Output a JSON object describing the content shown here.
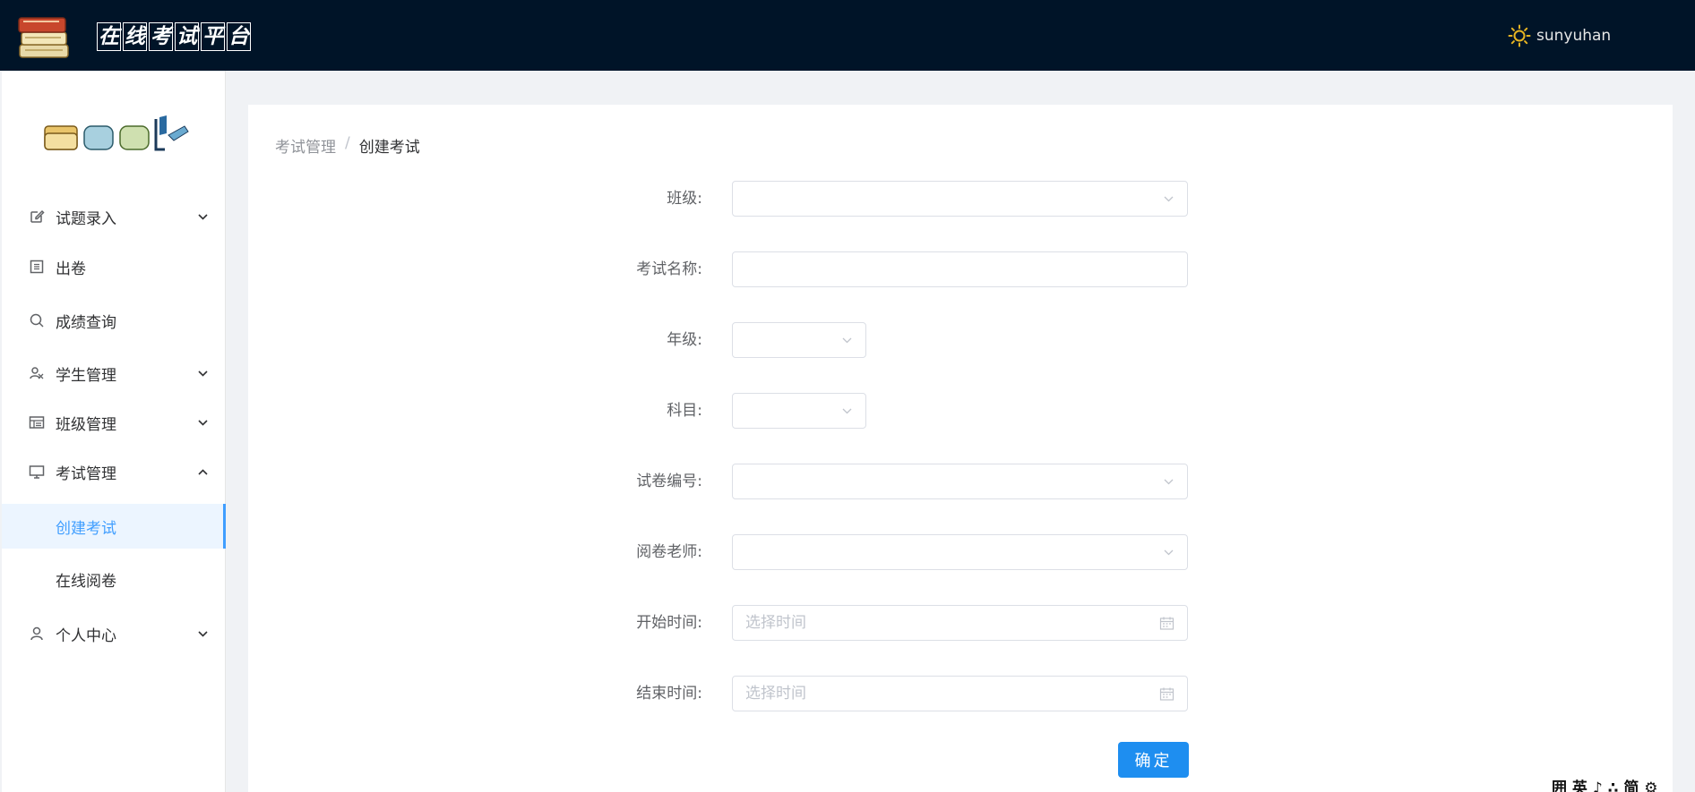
{
  "header": {
    "title_chars": [
      "在",
      "线",
      "考",
      "试",
      "平",
      "台"
    ],
    "username": "sunyuhan"
  },
  "sidebar": {
    "items": [
      {
        "label": "试题录入",
        "icon": "edit-icon",
        "arrow": "down"
      },
      {
        "label": "出卷",
        "icon": "document-icon",
        "arrow": ""
      },
      {
        "label": "成绩查询",
        "icon": "search-icon",
        "arrow": ""
      },
      {
        "label": "学生管理",
        "icon": "user-group-icon",
        "arrow": "down"
      },
      {
        "label": "班级管理",
        "icon": "table-icon",
        "arrow": "down"
      },
      {
        "label": "考试管理",
        "icon": "monitor-icon",
        "arrow": "up"
      },
      {
        "label": "创建考试",
        "icon": "",
        "arrow": "",
        "sub": true,
        "active": true
      },
      {
        "label": "在线阅卷",
        "icon": "",
        "arrow": "",
        "sub": true
      },
      {
        "label": "个人中心",
        "icon": "user-icon",
        "arrow": "down"
      }
    ]
  },
  "breadcrumb": {
    "first": "考试管理",
    "separator": "/",
    "last": "创建考试"
  },
  "form": {
    "class_label": "班级:",
    "exam_name_label": "考试名称:",
    "grade_label": "年级:",
    "subject_label": "科目:",
    "paper_no_label": "试卷编号:",
    "teacher_label": "阅卷老师:",
    "start_label": "开始时间:",
    "start_placeholder": "选择时间",
    "end_label": "结束时间:",
    "end_placeholder": "选择时间",
    "submit_label": "确定"
  },
  "ime": {
    "text": "囲 英 ♪ ∴ 简 ⚙"
  },
  "colors": {
    "header_bg": "#001428",
    "primary": "#409eff",
    "button": "#1e8ef0"
  }
}
